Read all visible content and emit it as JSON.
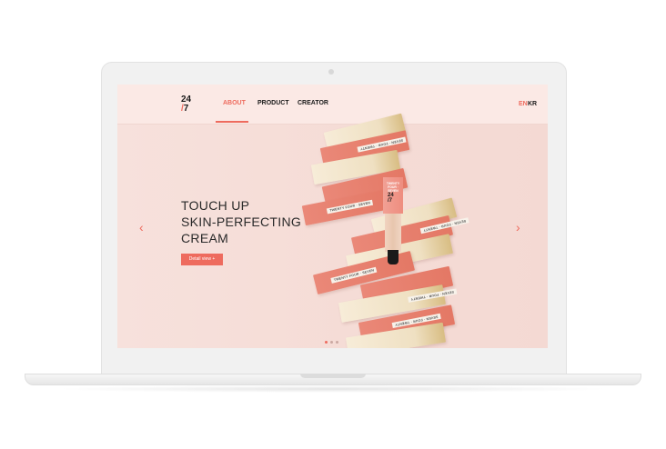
{
  "brand": {
    "logo_top": "24",
    "logo_slash": "/",
    "logo_bottom": "7"
  },
  "nav": {
    "items": [
      {
        "label": "ABOUT",
        "active": true
      },
      {
        "label": "PRODUCT",
        "active": false
      },
      {
        "label": "CREATOR",
        "active": false
      }
    ]
  },
  "lang": {
    "en": "EN",
    "kr": "KR"
  },
  "hero": {
    "title_lines": [
      "TOUCH UP",
      "SKIN-PERFECTING",
      "CREAM"
    ],
    "button_label": "Detail view +",
    "prev_arrow": "‹",
    "next_arrow": "›",
    "slide_count": 3,
    "active_slide": 1
  },
  "product": {
    "box_label": "TWENTY FOUR · SEVEN",
    "box_label_flipped": "SEVEN · FOUR · TWENTY",
    "tube_text": "TWENTY FOUR · SEVEN",
    "tube_logo_top": "24",
    "tube_logo_bottom": "/7"
  },
  "colors": {
    "accent": "#ee6b5e",
    "hero_bg": "#f7e1dc",
    "header_bg": "#fbe9e5"
  },
  "icons": {
    "prev": "chevron-left-icon",
    "next": "chevron-right-icon"
  }
}
